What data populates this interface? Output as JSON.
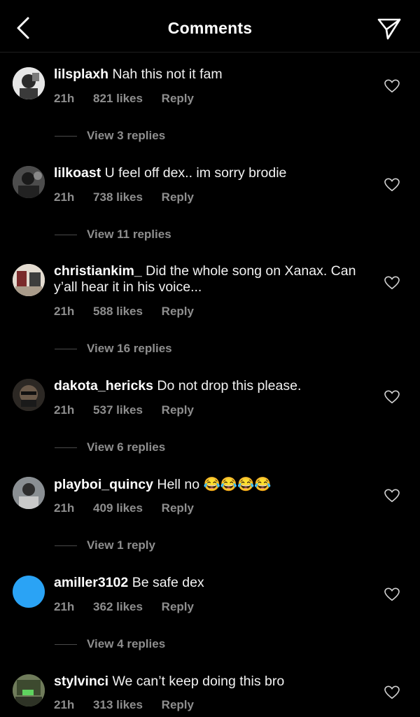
{
  "header": {
    "title": "Comments"
  },
  "comments": [
    {
      "username": "lilsplaxh",
      "text": "Nah this not it fam",
      "time": "21h",
      "likes": "821 likes",
      "reply": "Reply",
      "view_replies": "View 3 replies"
    },
    {
      "username": "lilkoast",
      "text": "U feel off dex.. im sorry brodie",
      "time": "21h",
      "likes": "738 likes",
      "reply": "Reply",
      "view_replies": "View 11 replies"
    },
    {
      "username": "christiankim_",
      "text": "Did the whole song on Xanax. Can y’all hear it in his voice...",
      "time": "21h",
      "likes": "588 likes",
      "reply": "Reply",
      "view_replies": "View 16 replies"
    },
    {
      "username": "dakota_hericks",
      "text": "Do not drop this please.",
      "time": "21h",
      "likes": "537 likes",
      "reply": "Reply",
      "view_replies": "View 6 replies"
    },
    {
      "username": "playboi_quincy",
      "text": "Hell no 😂😂😂😂",
      "time": "21h",
      "likes": "409 likes",
      "reply": "Reply",
      "view_replies": "View 1 reply"
    },
    {
      "username": "amiller3102",
      "text": "Be safe dex",
      "time": "21h",
      "likes": "362 likes",
      "reply": "Reply",
      "view_replies": "View 4 replies"
    },
    {
      "username": "stylvinci",
      "text": "We can’t keep doing this bro",
      "time": "21h",
      "likes": "313 likes",
      "reply": "Reply"
    }
  ],
  "icons": {
    "back": "chevron-left-icon",
    "send": "paper-plane-icon",
    "like": "heart-outline-icon"
  },
  "colors": {
    "background": "#000000",
    "secondary_text": "#8e8e8e",
    "avatar_blue": "#2aa3f5"
  }
}
